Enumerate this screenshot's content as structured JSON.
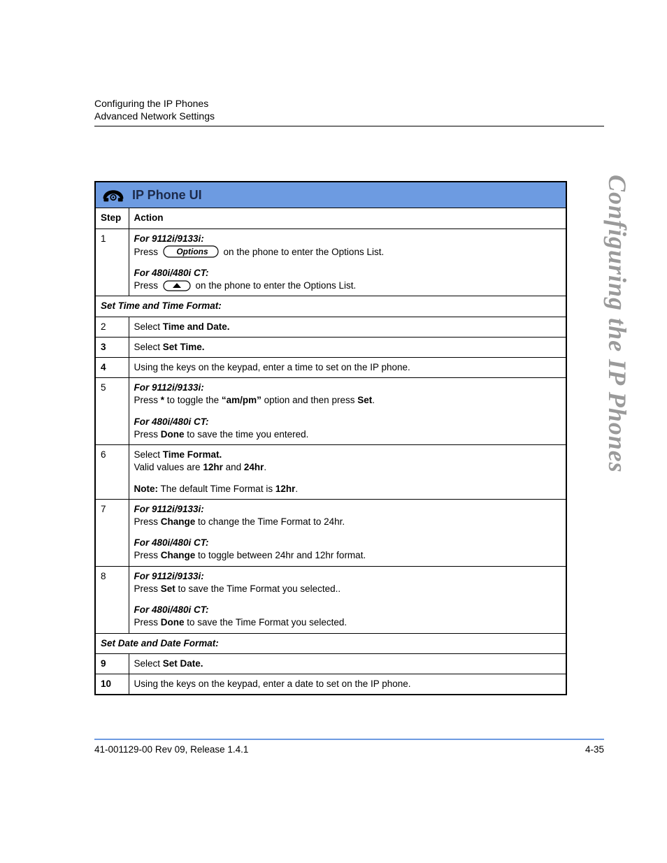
{
  "header": {
    "line1": "Configuring the IP Phones",
    "line2": "Advanced Network Settings"
  },
  "side_title": "Configuring the IP Phones",
  "table": {
    "title": "IP Phone UI",
    "col_step": "Step",
    "col_action": "Action",
    "section1": "Set Time and Time Format:",
    "section2": "Set Date and Date Format:",
    "rows": {
      "r1": {
        "num": "1",
        "p1_em": "For 9112i/9133i:",
        "p1_a": "Press",
        "p1_b": "on the phone to enter the Options List.",
        "p2_em": "For 480i/480i CT:",
        "p2_a": "Press",
        "p2_b": "on the phone to enter the Options List."
      },
      "r2": {
        "num": "2",
        "a": "Select ",
        "b": "Time and Date."
      },
      "r3": {
        "num": "3",
        "a": "Select ",
        "b": "Set Time."
      },
      "r4": {
        "num": "4",
        "t": "Using the keys on the keypad, enter a time to set on the IP phone."
      },
      "r5": {
        "num": "5",
        "p1_em": "For 9112i/9133i:",
        "p1_a": "Press ",
        "p1_b": "* ",
        "p1_c": "to toggle the ",
        "p1_d": "“am/pm”",
        "p1_e": " option and then press ",
        "p1_f": "Set",
        "p1_g": ".",
        "p2_em": "For 480i/480i CT:",
        "p2_a": "Press ",
        "p2_b": "Done",
        "p2_c": " to save the time you entered."
      },
      "r6": {
        "num": "6",
        "a": "Select ",
        "b": "Time Format.",
        "c": "Valid values are ",
        "d": "12hr",
        "e": " and ",
        "f": "24hr",
        "g": ".",
        "h": "Note:",
        "i": " The default Time Format is ",
        "j": "12hr",
        "k": "."
      },
      "r7": {
        "num": "7",
        "p1_em": "For 9112i/9133i:",
        "p1_a": "Press ",
        "p1_b": "Change",
        "p1_c": " to change the Time Format to 24hr.",
        "p2_em": "For 480i/480i CT:",
        "p2_a": "Press ",
        "p2_b": "Change",
        "p2_c": " to toggle between 24hr and 12hr format."
      },
      "r8": {
        "num": "8",
        "p1_em": "For 9112i/9133i:",
        "p1_a": "Press ",
        "p1_b": "Set",
        "p1_c": " to save the Time Format you selected..",
        "p2_em": "For 480i/480i CT:",
        "p2_a": "Press ",
        "p2_b": "Done",
        "p2_c": " to save the Time Format you selected."
      },
      "r9": {
        "num": "9",
        "a": "Select ",
        "b": "Set Date."
      },
      "r10": {
        "num": "10",
        "t": "Using the keys on the keypad, enter a date to set on the IP phone."
      }
    }
  },
  "footer": {
    "left": "41-001129-00 Rev 09, Release 1.4.1",
    "right": "4-35"
  },
  "icons": {
    "options_label": "Options"
  }
}
